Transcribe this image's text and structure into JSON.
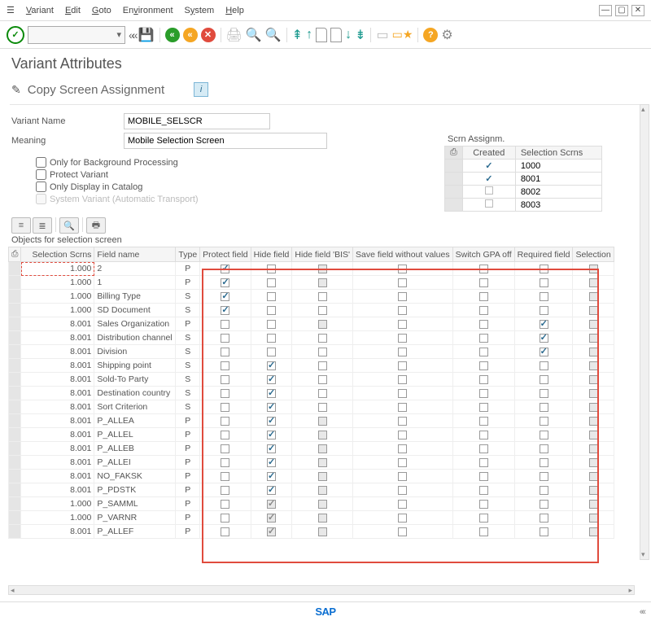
{
  "menu": {
    "variant": "Variant",
    "edit": "Edit",
    "goto": "Goto",
    "environment": "Environment",
    "system": "System",
    "help": "Help"
  },
  "title": "Variant Attributes",
  "subheader": "Copy Screen Assignment",
  "form": {
    "variant_name_label": "Variant Name",
    "variant_name": "MOBILE_SELSCR",
    "meaning_label": "Meaning",
    "meaning": "Mobile Selection Screen"
  },
  "checks": {
    "bg": "Only for Background Processing",
    "protect": "Protect Variant",
    "catalog": "Only Display in Catalog",
    "sysvar": "System Variant (Automatic Transport)"
  },
  "scrn_assign": {
    "title": "Scrn Assignm.",
    "hdr_created": "Created",
    "hdr_sel": "Selection Scrns",
    "rows": [
      {
        "created": true,
        "scrn": "1000"
      },
      {
        "created": true,
        "scrn": "8001"
      },
      {
        "created": false,
        "scrn": "8002"
      },
      {
        "created": false,
        "scrn": "8003"
      }
    ]
  },
  "objects_label": "Objects for selection screen",
  "table": {
    "headers": {
      "scrn": "Selection Scrns",
      "fname": "Field name",
      "type": "Type",
      "protect": "Protect field",
      "hide": "Hide field",
      "hidebis": "Hide field 'BIS'",
      "savewo": "Save field without values",
      "gpa": "Switch GPA off",
      "req": "Required field",
      "sel": "Selection"
    },
    "rows": [
      {
        "scrn": "1.000",
        "fname": "2",
        "type": "P",
        "protect": true
      },
      {
        "scrn": "1.000",
        "fname": "1",
        "type": "P",
        "protect": true
      },
      {
        "scrn": "1.000",
        "fname": "Billing Type",
        "type": "S",
        "protect": true
      },
      {
        "scrn": "1.000",
        "fname": "SD Document",
        "type": "S",
        "protect": true
      },
      {
        "scrn": "8.001",
        "fname": "Sales Organization",
        "type": "P",
        "req": true
      },
      {
        "scrn": "8.001",
        "fname": "Distribution channel",
        "type": "S",
        "req": true
      },
      {
        "scrn": "8.001",
        "fname": "Division",
        "type": "S",
        "req": true
      },
      {
        "scrn": "8.001",
        "fname": "Shipping point",
        "type": "S",
        "hide": true
      },
      {
        "scrn": "8.001",
        "fname": "Sold-To Party",
        "type": "S",
        "hide": true
      },
      {
        "scrn": "8.001",
        "fname": "Destination country",
        "type": "S",
        "hide": true
      },
      {
        "scrn": "8.001",
        "fname": "Sort Criterion",
        "type": "S",
        "hide": true
      },
      {
        "scrn": "8.001",
        "fname": "P_ALLEA",
        "type": "P",
        "hide": true
      },
      {
        "scrn": "8.001",
        "fname": "P_ALLEL",
        "type": "P",
        "hide": true
      },
      {
        "scrn": "8.001",
        "fname": "P_ALLEB",
        "type": "P",
        "hide": true
      },
      {
        "scrn": "8.001",
        "fname": "P_ALLEI",
        "type": "P",
        "hide": true
      },
      {
        "scrn": "8.001",
        "fname": "NO_FAKSK",
        "type": "P",
        "hide": true
      },
      {
        "scrn": "8.001",
        "fname": "P_PDSTK",
        "type": "P",
        "hide": true
      },
      {
        "scrn": "1.000",
        "fname": "P_SAMML",
        "type": "P",
        "hide": "dis"
      },
      {
        "scrn": "1.000",
        "fname": "P_VARNR",
        "type": "P",
        "hide": "dis"
      },
      {
        "scrn": "8.001",
        "fname": "P_ALLEF",
        "type": "P",
        "hide": "dis"
      }
    ]
  }
}
